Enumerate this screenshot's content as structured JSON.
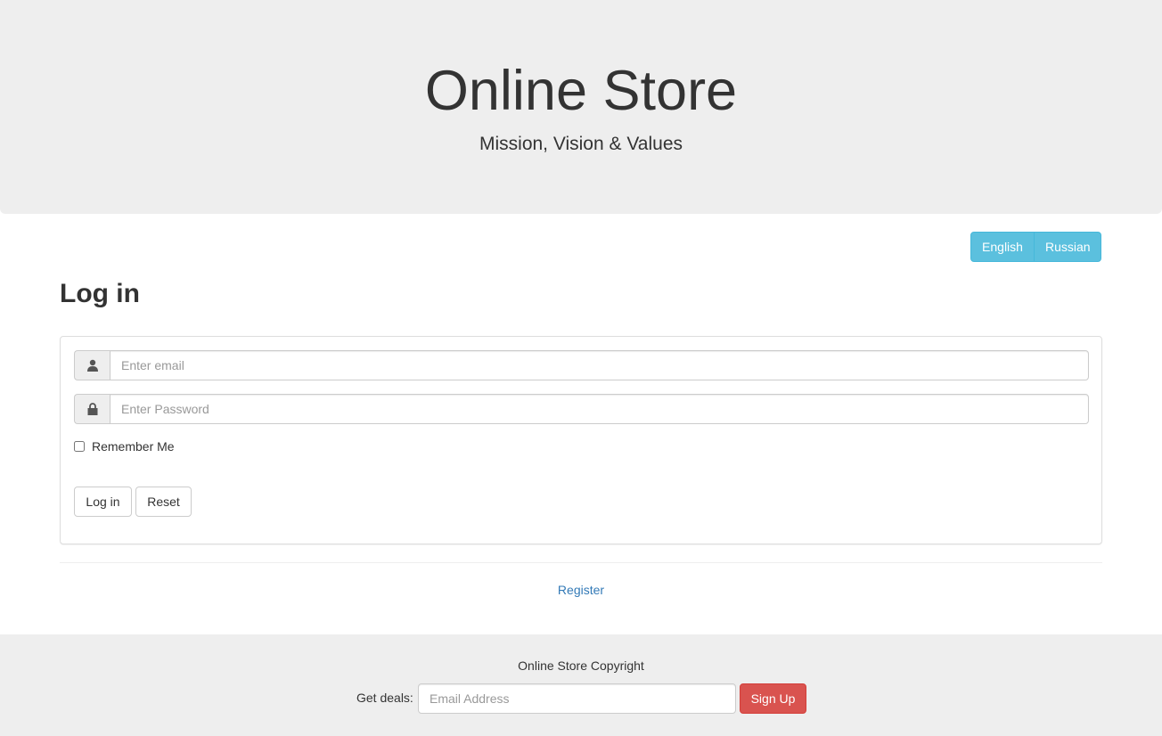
{
  "header": {
    "title": "Online Store",
    "subtitle": "Mission, Vision & Values"
  },
  "language": {
    "options": [
      "English",
      "Russian"
    ]
  },
  "login": {
    "heading": "Log in",
    "email_placeholder": "Enter email",
    "email_icon": "user-icon",
    "password_placeholder": "Enter Password",
    "password_icon": "lock-icon",
    "remember_label": "Remember Me",
    "login_label": "Log in",
    "reset_label": "Reset"
  },
  "register_link": "Register",
  "footer": {
    "copyright": "Online Store Copyright",
    "deals_label": "Get deals:",
    "email_placeholder": "Email Address",
    "signup_label": "Sign Up"
  },
  "colors": {
    "info": "#5bc0de",
    "danger": "#d9534f",
    "link": "#337ab7",
    "jumbotron_bg": "#eeeeee"
  }
}
